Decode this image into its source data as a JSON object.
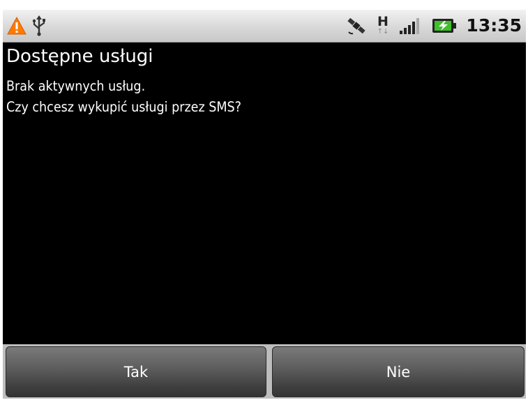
{
  "status_bar": {
    "time": "13:35",
    "network_type": "H",
    "icons": [
      "warning-icon",
      "usb-icon",
      "gps-icon",
      "network-h-icon",
      "signal-icon",
      "battery-charging-icon"
    ],
    "colors": {
      "warning": "#ff7a00",
      "battery": "#3fbf2a"
    }
  },
  "dialog": {
    "title": "Dostępne usługi",
    "line1": "Brak aktywnych usług.",
    "line2": "Czy chcesz wykupić usługi przez SMS?"
  },
  "buttons": {
    "yes": "Tak",
    "no": "Nie"
  }
}
